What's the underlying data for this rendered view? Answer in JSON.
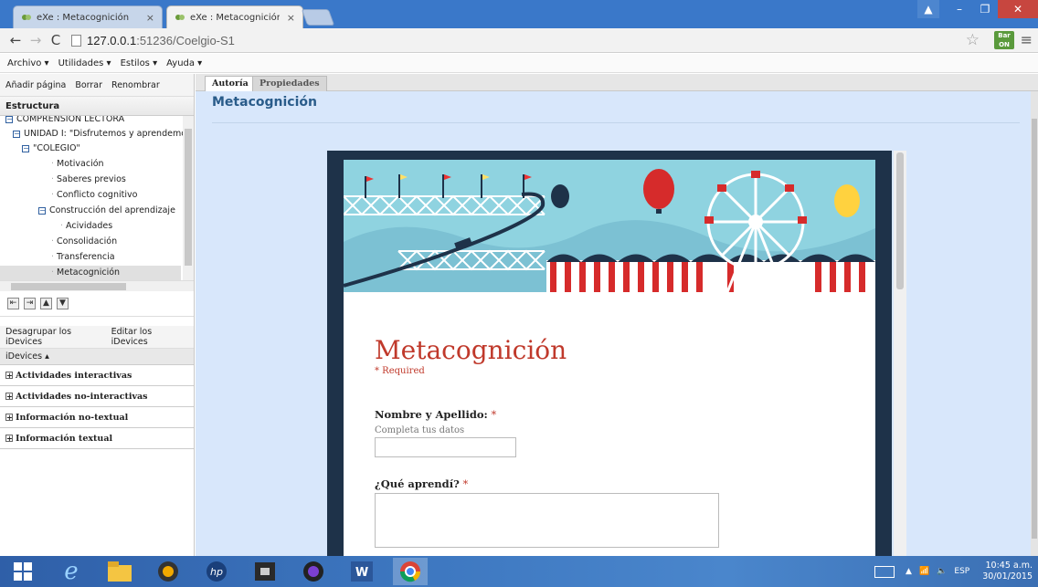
{
  "browser": {
    "tabs": [
      {
        "label": "eXe : Metacognición",
        "close": "×"
      },
      {
        "label": "eXe : Metacognición",
        "close": "×"
      }
    ],
    "url_host": "127.0.0.1",
    "url_rest": ":51236/Coelgio-S1",
    "ext_label_top": "Bar",
    "ext_label_bottom": "ON"
  },
  "menubar": [
    "Archivo ▾",
    "Utilidades ▾",
    "Estilos ▾",
    "Ayuda ▾"
  ],
  "left": {
    "page_actions": [
      "Añadir página",
      "Borrar",
      "Renombrar"
    ],
    "structure_title": "Estructura",
    "tree": [
      {
        "label": "COMPRENSION LECTORA",
        "level": 0,
        "toggle": true
      },
      {
        "label": "UNIDAD I: \"Disfrutemos y aprendemos",
        "level": 1,
        "toggle": true
      },
      {
        "label": "\"COLEGIO\"",
        "level": 2,
        "toggle": true
      },
      {
        "label": "Motivación",
        "level": 3
      },
      {
        "label": "Saberes previos",
        "level": 3
      },
      {
        "label": "Conflicto cognitivo",
        "level": 3
      },
      {
        "label": "Construcción del aprendizaje",
        "level": 3,
        "toggle": true
      },
      {
        "label": "Acividades",
        "level": 4
      },
      {
        "label": "Consolidación",
        "level": 3
      },
      {
        "label": "Transferencia",
        "level": 3
      },
      {
        "label": "Metacognición",
        "level": 3,
        "selected": true
      }
    ],
    "idevice_actions": [
      "Desagrupar los iDevices",
      "Editar los iDevices"
    ],
    "idevices_header": "iDevices ▴",
    "categories": [
      "Actividades interactivas",
      "Actividades no-interactivas",
      "Información no-textual",
      "Información textual"
    ]
  },
  "right": {
    "tabs": [
      "Autoría",
      "Propiedades"
    ],
    "page_title": "Metacognición"
  },
  "form": {
    "title": "Metacognición",
    "required_note": "* Required",
    "q1_label": "Nombre y Apellido:",
    "q1_help": "Completa tus datos",
    "q2_label": "¿Qué aprendí?",
    "star": " *"
  },
  "tray": {
    "lang": "ESP",
    "time": "10:45 a.m.",
    "date": "30/01/2015"
  },
  "colors": {
    "accent_blue": "#3a78c9",
    "form_title_red": "#c0392b",
    "editor_bg": "#d8e7fb"
  }
}
